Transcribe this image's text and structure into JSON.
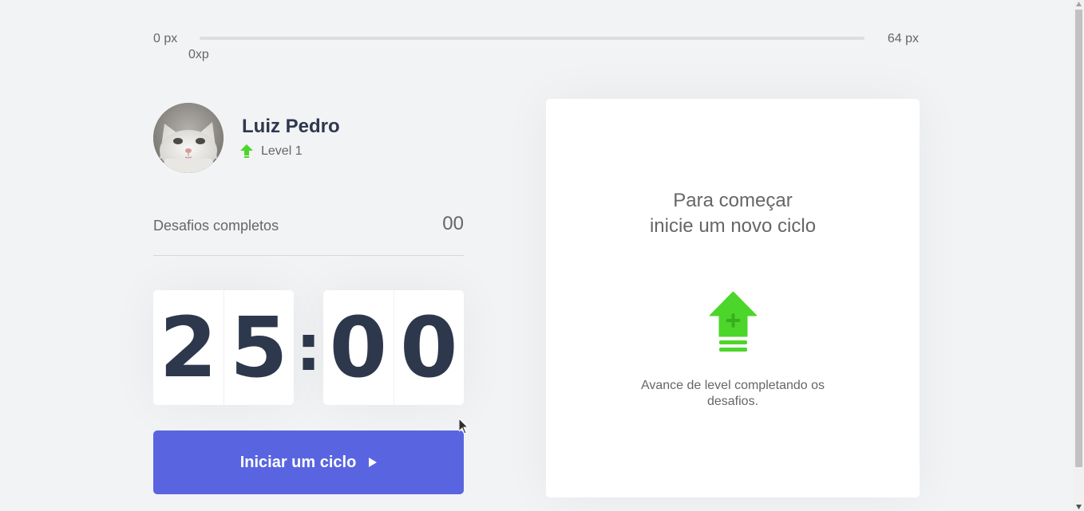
{
  "xp_bar": {
    "min_label": "0 px",
    "max_label": "64 px",
    "current_label": "0xp",
    "progress_fraction": 0
  },
  "profile": {
    "name": "Luiz Pedro",
    "level": "Level 1",
    "avatar_icon": "cat-photo-avatar"
  },
  "completed_challenges": {
    "label": "Desafios completos",
    "value": "00"
  },
  "countdown": {
    "minute_left": "2",
    "minute_right": "5",
    "separator": ":",
    "second_left": "0",
    "second_right": "0"
  },
  "start_button": {
    "label": "Iniciar um ciclo",
    "icon": "play-icon"
  },
  "challenge_box": {
    "title_line1": "Para começar",
    "title_line2": "inicie um novo ciclo",
    "icon": "level-up-icon",
    "description": "Avance de level completando os desafios."
  },
  "colors": {
    "background": "#f2f3f5",
    "text": "#666666",
    "title": "#2e384d",
    "accent_blue": "#5965e0",
    "green": "#4cd62b"
  }
}
